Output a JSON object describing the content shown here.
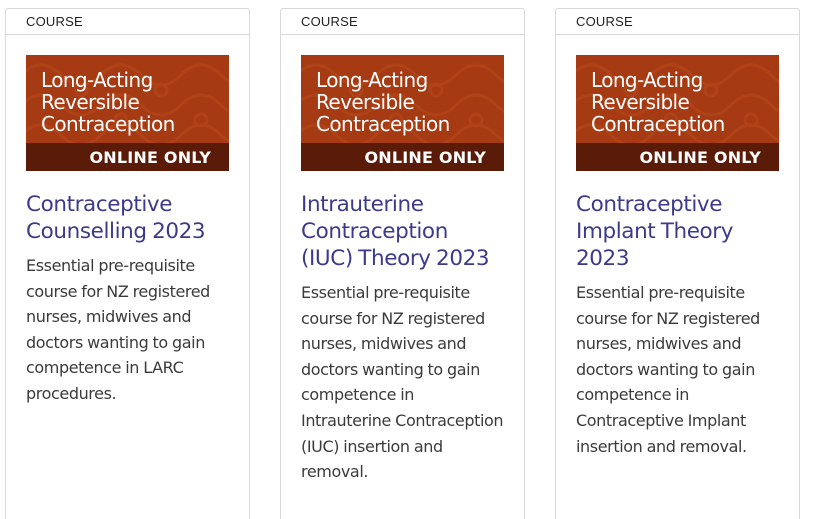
{
  "courses": [
    {
      "tag": "COURSE",
      "banner": {
        "text": "Long-Acting\nReversible\nContraception",
        "strip": "ONLINE ONLY"
      },
      "title": "Contraceptive Counselling 2023",
      "description": "Essential pre-requisite course for NZ registered nurses, midwives and doctors wanting to gain competence in LARC procedures."
    },
    {
      "tag": "COURSE",
      "banner": {
        "text": "Long-Acting\nReversible\nContraception",
        "strip": "ONLINE ONLY"
      },
      "title": "Intrauterine Contraception (IUC) Theory 2023",
      "description": "Essential pre-requisite course for NZ registered nurses, midwives and doctors wanting to gain competence in Intrauterine Contraception (IUC) insertion and removal."
    },
    {
      "tag": "COURSE",
      "banner": {
        "text": "Long-Acting\nReversible\nContraception",
        "strip": "ONLINE ONLY"
      },
      "title": "Contraceptive Implant Theory 2023",
      "description": "Essential pre-requisite course for NZ registered nurses, midwives and doctors wanting to gain competence in Contraceptive Implant insertion and removal."
    }
  ],
  "colors": {
    "title": "#3d3a8c",
    "banner_bg": "#a63a12",
    "banner_strip": "#5a1c08",
    "border": "#d9d9d9"
  }
}
